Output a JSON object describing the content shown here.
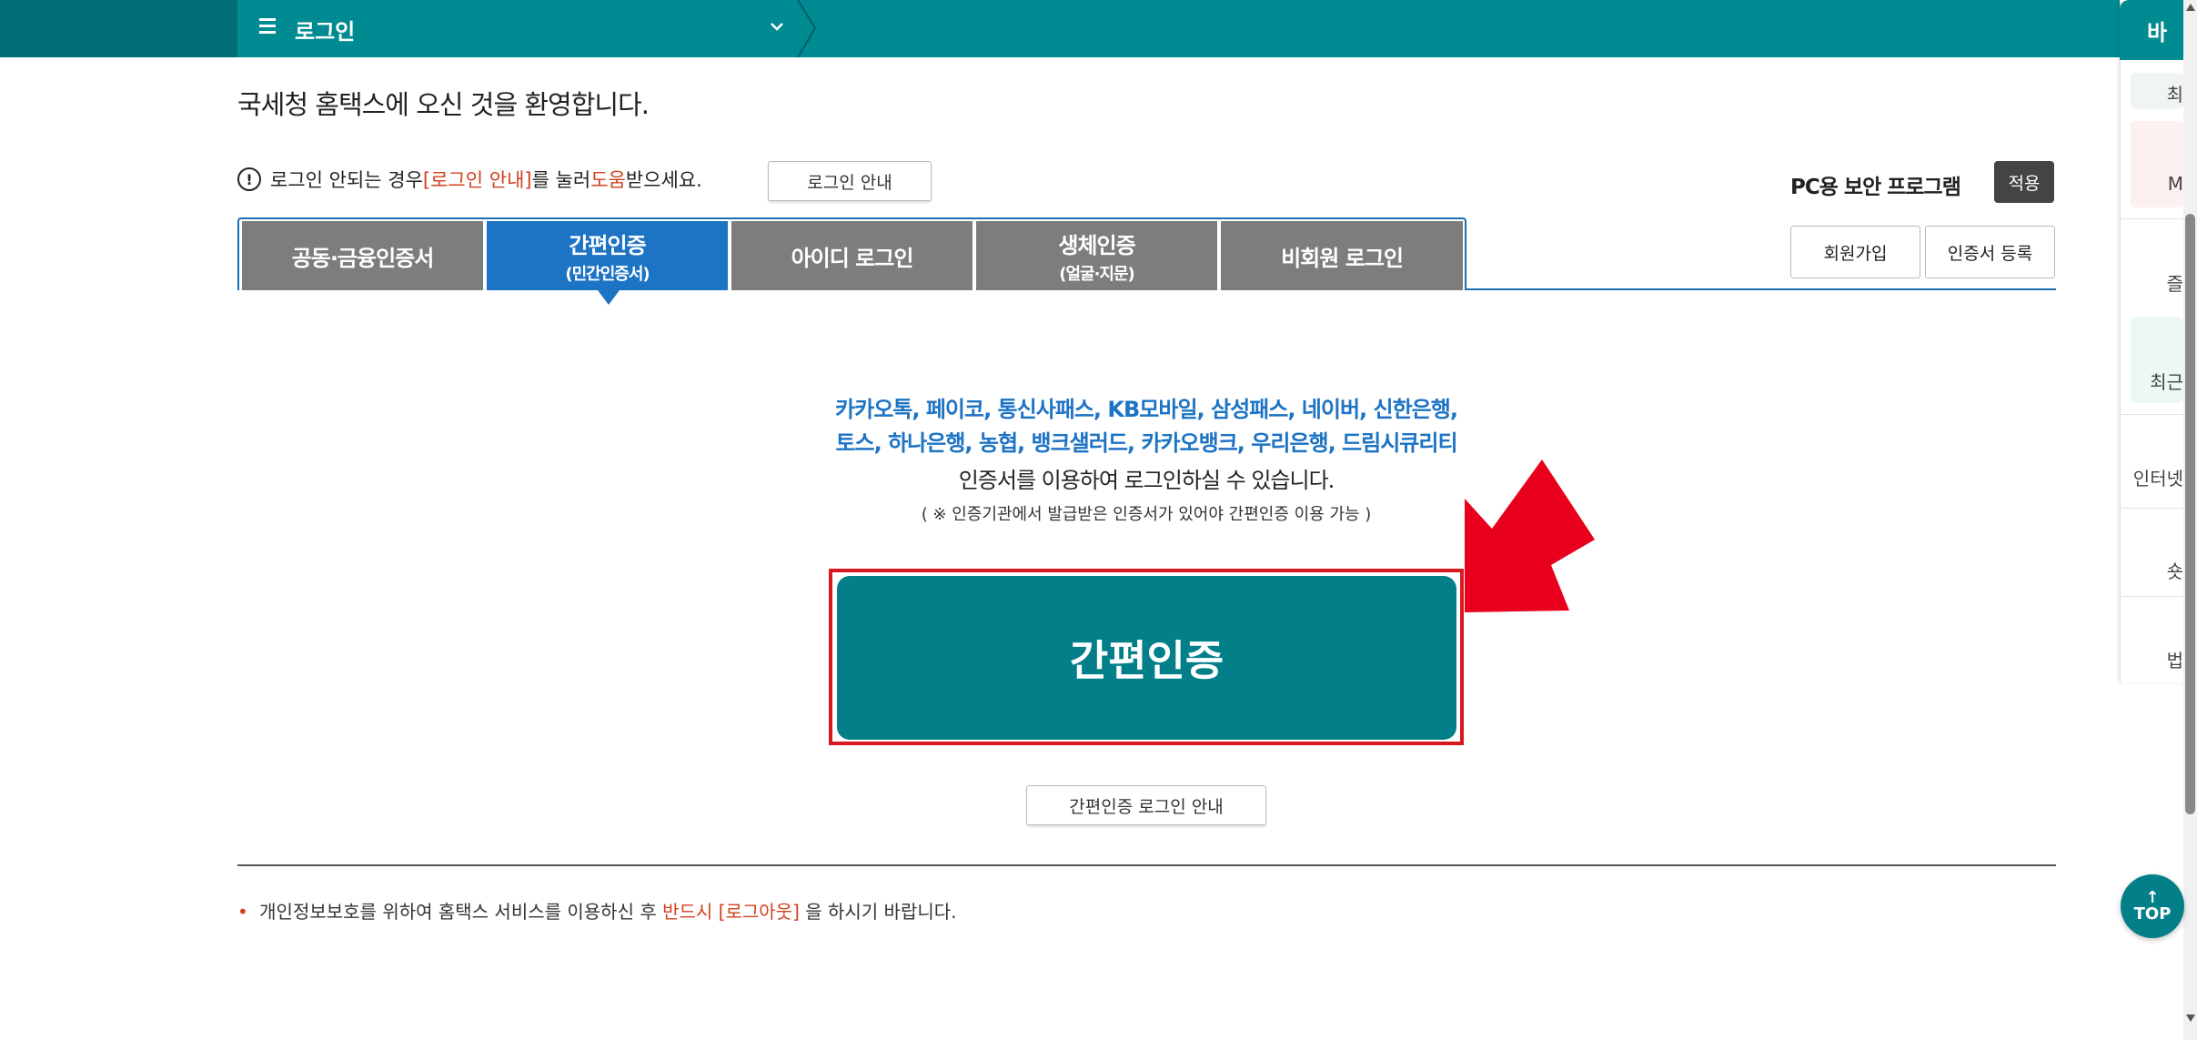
{
  "topbar": {
    "menu_title": "로그인"
  },
  "welcome": "국세청 홈택스에 오신 것을 환영합니다.",
  "notice": {
    "alert_glyph": "!",
    "part1": "로그인 안되는 경우 ",
    "link": "[로그인 안내]",
    "part2": "를 눌러 ",
    "help": "도움",
    "part3": "받으세요.",
    "button": "로그인 안내"
  },
  "security": {
    "label": "PC용 보안 프로그램",
    "apply": "적용"
  },
  "actions": {
    "join": "회원가입",
    "cert_register": "인증서 등록"
  },
  "tabs": [
    {
      "label": "공동·금융인증서",
      "sub": ""
    },
    {
      "label": "간편인증",
      "sub": "(민간인증서)"
    },
    {
      "label": "아이디 로그인",
      "sub": ""
    },
    {
      "label": "생체인증",
      "sub": "(얼굴·지문)"
    },
    {
      "label": "비회원 로그인",
      "sub": ""
    }
  ],
  "main": {
    "providers_line1": "카카오톡, 페이코, 통신사패스, KB모바일, 삼성패스, 네이버, 신한은행,",
    "providers_line2": "토스, 하나은행, 농협, 뱅크샐러드, 카카오뱅크, 우리은행, 드림시큐리티",
    "desc": "인증서를 이용하여 로그인하실 수 있습니다.",
    "note": "( ※ 인증기관에서 발급받은 인증서가 있어야 간편인증 이용 가능 )",
    "simple_button": "간편인증",
    "guide_button": "간편인증 로그인 안내"
  },
  "footer": {
    "dot": "•",
    "part1": "개인정보보호를 위하여 홈택스 서비스를 이용하신 후 ",
    "red": "반드시 [로그아웃]",
    "part2": "을 하시기 바랍니다."
  },
  "side_panel": {
    "head": "바",
    "rows": [
      "최",
      "M",
      "즐",
      "최근",
      "인터넷",
      "숏",
      "법"
    ]
  },
  "top_button": {
    "arrow": "↑",
    "label": "TOP"
  },
  "colors": {
    "teal": "#008a92",
    "blue": "#1d73c4",
    "red": "#d7191f",
    "gray_tab": "#7d7d7d"
  }
}
